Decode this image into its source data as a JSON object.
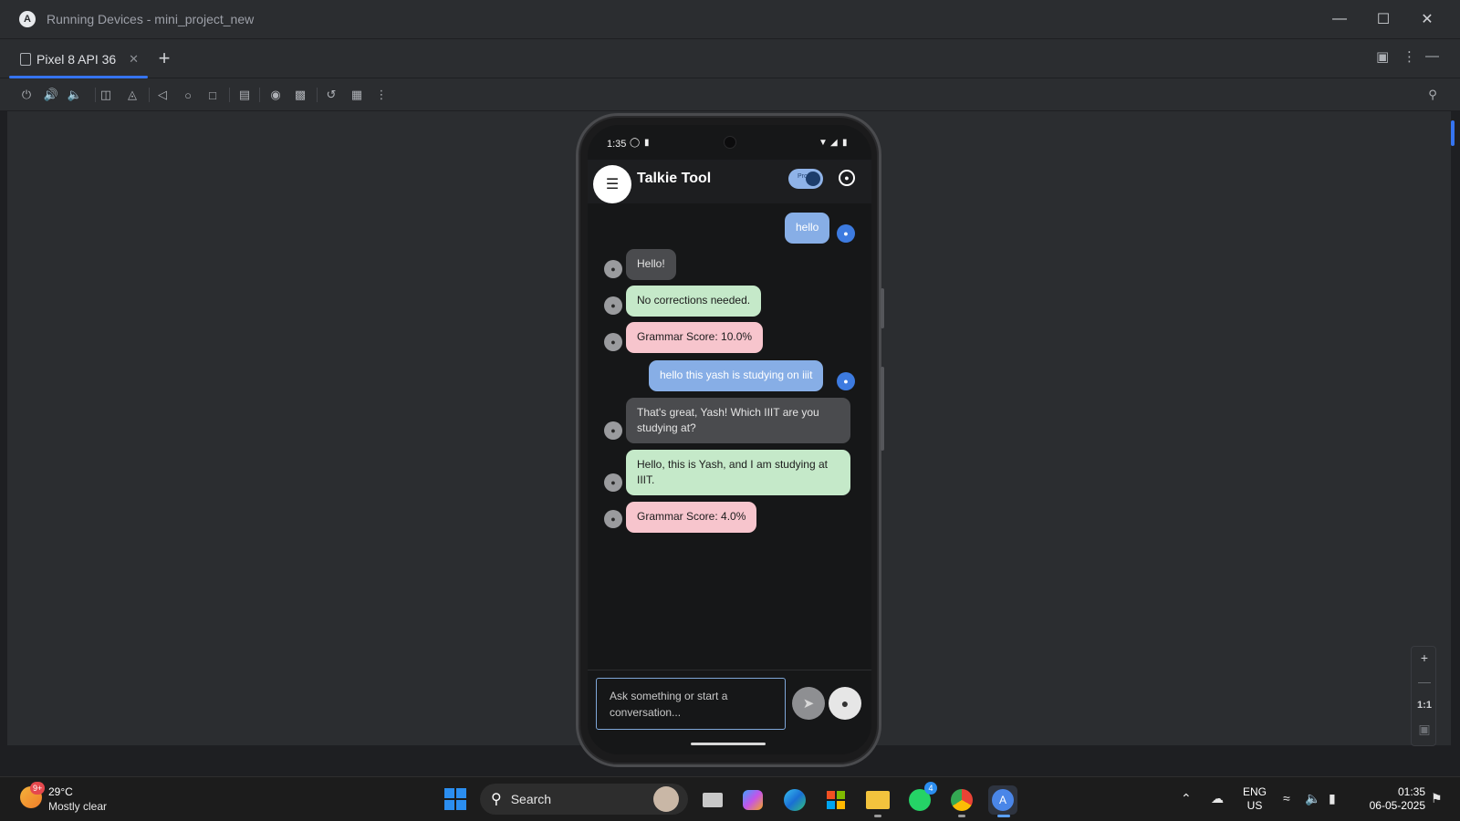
{
  "window": {
    "title": "Running Devices - mini_project_new",
    "controls": [
      "minimize",
      "maximize",
      "close"
    ]
  },
  "tabs": [
    {
      "label": "Pixel 8 API 36",
      "active": true
    }
  ],
  "toolbar": {
    "icons": [
      "power-icon",
      "volume-up-icon",
      "volume-down-icon",
      "rotate-left-icon",
      "rotate-right-icon",
      "back-icon",
      "home-icon",
      "overview-icon",
      "fold-icon",
      "screenshot-icon",
      "screen-record-icon",
      "reset-icon",
      "snapshot-icon",
      "more-options-icon"
    ]
  },
  "device": {
    "statusbar": {
      "time": "1:35"
    },
    "app": {
      "title": "Talkie Tool",
      "toggle_label": "Pro",
      "toggle_on": true
    },
    "messages": [
      {
        "from": "user",
        "kind": "text",
        "text": "hello"
      },
      {
        "from": "bot",
        "kind": "reply",
        "text": "Hello!"
      },
      {
        "from": "bot",
        "kind": "correction",
        "text": "No corrections needed."
      },
      {
        "from": "bot",
        "kind": "score",
        "text": "Grammar Score: 10.0%"
      },
      {
        "from": "user",
        "kind": "text",
        "text": "hello this yash is studying on iiit"
      },
      {
        "from": "bot",
        "kind": "reply",
        "text": "That's great, Yash!  Which IIIT are you studying at?"
      },
      {
        "from": "bot",
        "kind": "correction",
        "text": "Hello, this is Yash, and I am studying at IIIT."
      },
      {
        "from": "bot",
        "kind": "score",
        "text": "Grammar Score: 4.0%"
      }
    ],
    "input": {
      "placeholder": "Ask something or start a conversation...",
      "value": ""
    }
  },
  "zoom": {
    "one_to_one": "1:1"
  },
  "taskbar": {
    "weather": {
      "badge": "9+",
      "temp": "29°C",
      "desc": "Mostly clear"
    },
    "search_label": "Search",
    "apps": [
      {
        "name": "task-view",
        "badge": ""
      },
      {
        "name": "copilot",
        "badge": ""
      },
      {
        "name": "edge",
        "badge": ""
      },
      {
        "name": "store",
        "badge": ""
      },
      {
        "name": "file-explorer",
        "badge": ""
      },
      {
        "name": "whatsapp",
        "badge": "4"
      },
      {
        "name": "chrome",
        "badge": ""
      },
      {
        "name": "android-studio",
        "badge": ""
      }
    ],
    "lang_top": "ENG",
    "lang_bottom": "US",
    "time": "01:35",
    "date": "06-05-2025"
  },
  "colors": {
    "accent": "#3574f0",
    "user_bubble": "#87aee6",
    "correction_bubble": "#c5e9c9",
    "score_bubble": "#f7c5cd",
    "bot_bubble": "#4a4b4e"
  }
}
